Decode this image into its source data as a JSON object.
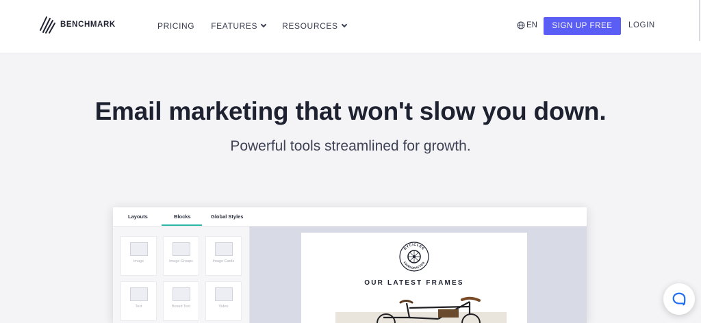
{
  "header": {
    "brand": "BENCHMARK",
    "nav": [
      {
        "label": "PRICING",
        "dropdown": false
      },
      {
        "label": "FEATURES",
        "dropdown": true
      },
      {
        "label": "RESOURCES",
        "dropdown": true
      }
    ],
    "language": "EN",
    "signup_label": "SIGN UP FREE",
    "login_label": "LOGIN"
  },
  "hero": {
    "title": "Email marketing that won't slow you down.",
    "subtitle": "Powerful tools streamlined for growth."
  },
  "editor": {
    "tabs": [
      "Layouts",
      "Blocks",
      "Global Styles"
    ],
    "active_tab": "Blocks",
    "blocks": [
      {
        "label": "Image",
        "icon": "image-icon"
      },
      {
        "label": "Image Groups",
        "icon": "image-groups-icon"
      },
      {
        "label": "Image Cards",
        "icon": "image-cards-icon"
      },
      {
        "label": "Text",
        "icon": "text-icon"
      },
      {
        "label": "Boxed Text",
        "icon": "boxed-text-icon"
      },
      {
        "label": "Video",
        "icon": "video-icon"
      }
    ],
    "preview": {
      "badge_top": "BYCICLES",
      "badge_bottom": "HANDCRAFTED",
      "heading": "OUR LATEST FRAMES"
    }
  },
  "colors": {
    "accent": "#5b5ef4",
    "tab_underline": "#2bb7a8",
    "chat": "#1f6ff2"
  }
}
